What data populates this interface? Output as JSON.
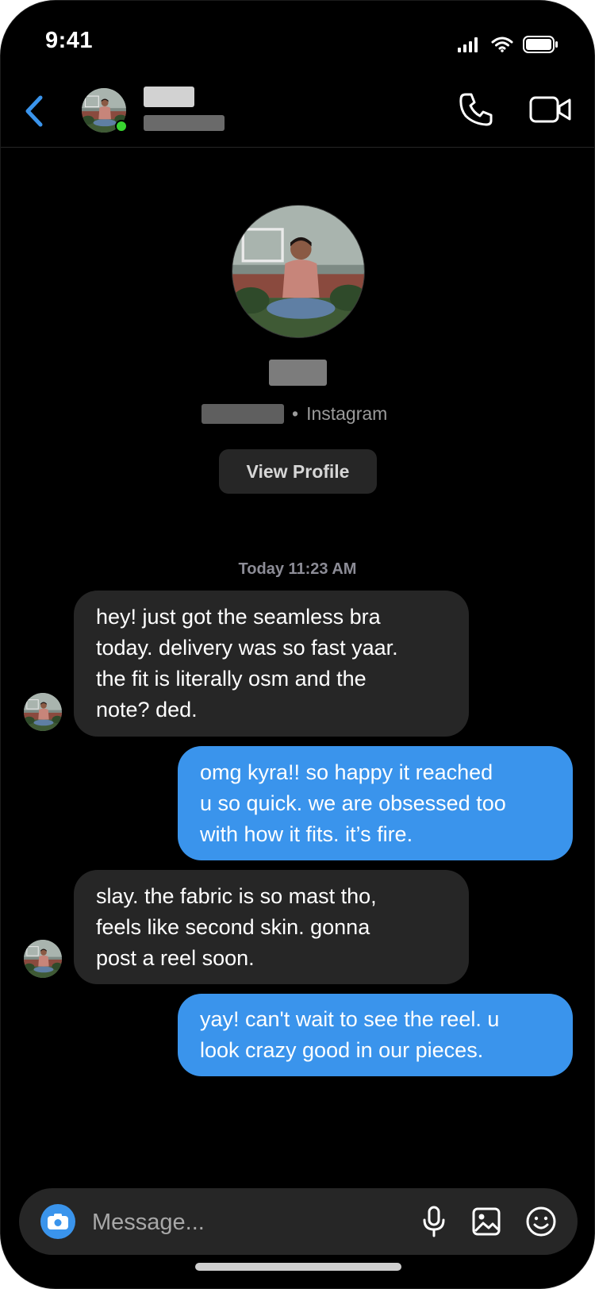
{
  "status_bar": {
    "time": "9:41"
  },
  "header": {
    "contact_name": "",
    "contact_handle": ""
  },
  "profile": {
    "platform": "Instagram",
    "view_profile_label": "View Profile"
  },
  "chat": {
    "timestamp": "Today 11:23 AM",
    "messages": [
      {
        "direction": "incoming",
        "text": "hey! just got the seamless bra\ntoday. delivery was so fast yaar.\nthe fit is literally osm and the\nnote? ded."
      },
      {
        "direction": "outgoing",
        "text": "omg kyra!! so happy it reached\nu so quick. we are obsessed too\nwith how it fits. it’s fire."
      },
      {
        "direction": "incoming",
        "text": "slay. the fabric is so mast tho,\nfeels like second skin. gonna\npost a reel soon."
      },
      {
        "direction": "outgoing",
        "text": "yay! can't wait to see the reel. u\nlook crazy good in our pieces."
      }
    ]
  },
  "composer": {
    "placeholder": "Message..."
  },
  "icons": {
    "back": "chevron-left-icon",
    "call": "phone-icon",
    "video": "video-camera-icon",
    "camera": "camera-icon",
    "mic": "microphone-icon",
    "gallery": "image-icon",
    "emoji": "smiley-icon"
  },
  "colors": {
    "accent": "#3a94ec",
    "incoming_bubble": "#262626",
    "online": "#38d430"
  }
}
